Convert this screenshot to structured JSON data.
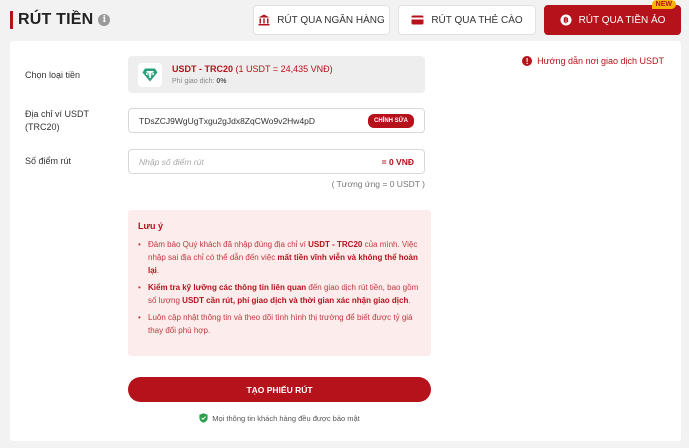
{
  "header": {
    "title": "RÚT TIỀN"
  },
  "tabs": [
    {
      "label": "RÚT QUA NGÂN HÀNG",
      "icon": "bank-icon"
    },
    {
      "label": "RÚT QUA THẺ CÀO",
      "icon": "card-icon"
    },
    {
      "label": "RÚT QUA TIỀN ẢO",
      "icon": "bitcoin-icon",
      "badge": "NEW",
      "active": true
    }
  ],
  "guide": {
    "label": "Hướng dẫn nơi giao dịch USDT"
  },
  "form": {
    "coin_type": {
      "label": "Chọn loại tiền",
      "name": "USDT - TRC20",
      "rate": "(1 USDT = 24,435 VNĐ)",
      "fee_label": "Phí giao dịch:",
      "fee_value": "0%"
    },
    "wallet": {
      "label": "Địa chỉ ví USDT (TRC20)",
      "address": "TDsZCJ9WgUgTxgu2gJdx8ZqCWo9v2Hw4pD",
      "edit_label": "CHỈNH SỬA"
    },
    "points": {
      "label": "Số điểm rút",
      "placeholder": "Nhập số điểm rút",
      "vnd_value": "= 0 VNĐ",
      "equivalent": "( Tương ứng = 0 USDT )"
    }
  },
  "notice": {
    "title": "Lưu ý",
    "items": [
      {
        "p1": "Đảm bảo Quý khách đã nhập đúng địa chỉ ví ",
        "b1": "USDT - TRC20",
        "p2": " của mình. Việc nhập sai địa chỉ có thể dẫn đến việc ",
        "b2": "mất tiền vĩnh viễn và không thể hoàn lại",
        "p3": "."
      },
      {
        "b1": "Kiểm tra kỹ lưỡng các thông tin liên quan",
        "p1": " đến giao dịch rút tiền, bao gồm số lượng ",
        "b2": "USDT cần rút, phí giao dịch và thời gian xác nhận giao dịch",
        "p2": "."
      },
      {
        "p1": "Luôn cập nhật thông tin và theo dõi tình hình thị trường để biết được tỷ giá thay đổi phù hợp."
      }
    ]
  },
  "submit": {
    "label": "TẠO PHIẾU RÚT"
  },
  "security": {
    "text": "Mọi thông tin khách hàng đều được bảo mật"
  },
  "colors": {
    "primary": "#b5121b",
    "notice_bg": "#fdecec",
    "usdt_green": "#26a17b",
    "badge": "#f5b400"
  }
}
